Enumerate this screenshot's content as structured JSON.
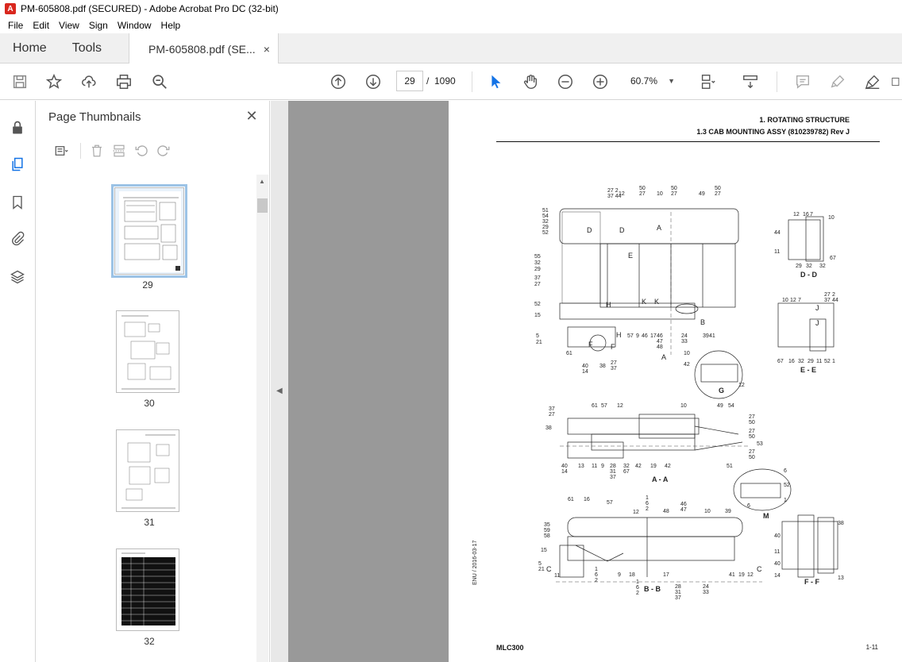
{
  "window": {
    "title": "PM-605808.pdf (SECURED) - Adobe Acrobat Pro DC (32-bit)",
    "app_icon": "acrobat-icon"
  },
  "menu": {
    "items": [
      "File",
      "Edit",
      "View",
      "Sign",
      "Window",
      "Help"
    ]
  },
  "tabs": {
    "home": "Home",
    "tools": "Tools",
    "document": "PM-605808.pdf (SE...",
    "close_symbol": "×"
  },
  "toolbar": {
    "icons": [
      "save-icon",
      "bookmark-star-icon",
      "upload-icon",
      "print-icon",
      "find-zoom-icon",
      "page-up-icon",
      "page-down-icon",
      "select-cursor-icon",
      "hand-tool-icon",
      "zoom-out-icon",
      "zoom-in-icon",
      "fit-page-icon",
      "scroll-mode-icon",
      "comment-icon",
      "highlight-icon",
      "sign-icon"
    ],
    "current_page": "29",
    "page_separator": "/",
    "total_pages": "1090",
    "zoom": "60.7%",
    "accent_color": "#1473e6"
  },
  "sidebar_rail": {
    "icons": [
      "lock-icon",
      "page-thumbnails-icon",
      "bookmark-icon",
      "attachment-icon",
      "layers-icon"
    ]
  },
  "thumbnails_panel": {
    "title": "Page Thumbnails",
    "close_symbol": "✕",
    "pages": [
      {
        "number": "29",
        "selected": true
      },
      {
        "number": "30",
        "selected": false
      },
      {
        "number": "31",
        "selected": false
      },
      {
        "number": "32",
        "selected": false
      }
    ]
  },
  "page": {
    "header_line1": "1. ROTATING STRUCTURE",
    "header_line2": "1.3 CAB MOUNTING ASSY (810239782) Rev J",
    "side_date": "ENU / 2016-03-17",
    "footer_left": "MLC300",
    "footer_right": "1-11",
    "view_labels": {
      "dd": "D - D",
      "ee": "E - E",
      "aa": "A - A",
      "bb": "B - B",
      "ff": "F - F",
      "g": "G",
      "m": "M"
    }
  }
}
